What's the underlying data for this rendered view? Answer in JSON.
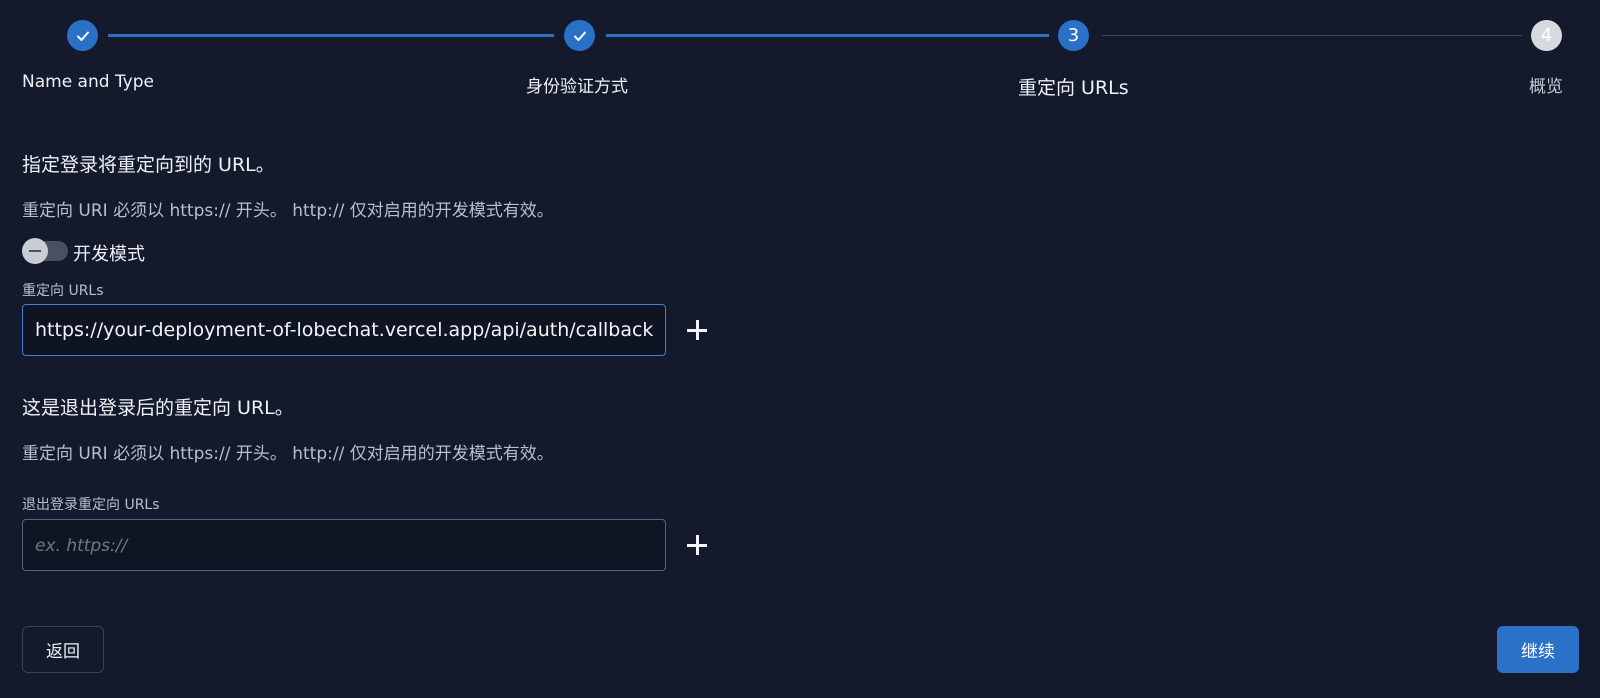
{
  "stepper": {
    "steps": [
      {
        "number": "1",
        "label": "Name and Type",
        "status": "complete"
      },
      {
        "number": "2",
        "label": "身份验证方式",
        "status": "complete"
      },
      {
        "number": "3",
        "label": "重定向 URLs",
        "status": "current"
      },
      {
        "number": "4",
        "label": "概览",
        "status": "pending"
      }
    ]
  },
  "redirect_section": {
    "heading": "指定登录将重定向到的 URL。",
    "description": "重定向 URI 必须以 https:// 开头。 http:// 仅对启用的开发模式有效。",
    "dev_mode_label": "开发模式",
    "dev_mode_enabled": false,
    "field_label": "重定向 URLs",
    "field_value": "https://your-deployment-of-lobechat.vercel.app/api/auth/callback/zitadel"
  },
  "logout_section": {
    "heading": "这是退出登录后的重定向 URL。",
    "description": "重定向 URI 必须以 https:// 开头。 http:// 仅对启用的开发模式有效。",
    "field_label": "退出登录重定向 URLs",
    "field_placeholder": "ex. https://",
    "field_value": ""
  },
  "footer": {
    "back_label": "返回",
    "continue_label": "继续"
  },
  "colors": {
    "background": "#141a2c",
    "accent": "#2a70c6",
    "pending_step": "#d6d9de"
  }
}
